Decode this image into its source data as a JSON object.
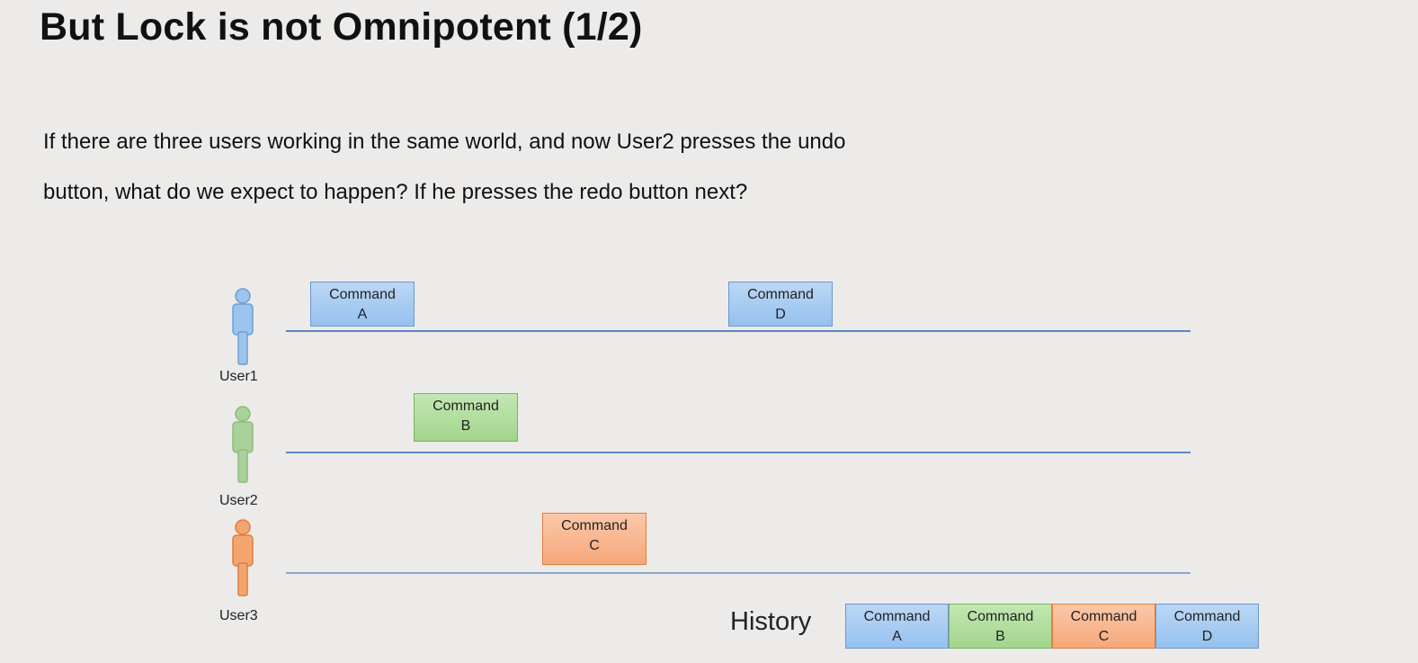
{
  "slide": {
    "title": "But Lock is not Omnipotent (1/2)",
    "body_line1": "If there are three users working in the same world, and now User2 presses the undo",
    "body_line2": "button, what do we expect to happen? If he presses the redo button next?"
  },
  "users": [
    {
      "label": "User1",
      "color": "#9cc4ec"
    },
    {
      "label": "User2",
      "color": "#a9d19a"
    },
    {
      "label": "User3",
      "color": "#f4a56e"
    }
  ],
  "commands": {
    "a": {
      "line1": "Command",
      "line2": "A",
      "user": "User1"
    },
    "b": {
      "line1": "Command",
      "line2": "B",
      "user": "User2"
    },
    "c": {
      "line1": "Command",
      "line2": "C",
      "user": "User3"
    },
    "d": {
      "line1": "Command",
      "line2": "D",
      "user": "User1"
    }
  },
  "history": {
    "label": "History",
    "items": [
      {
        "line1": "Command",
        "line2": "A"
      },
      {
        "line1": "Command",
        "line2": "B"
      },
      {
        "line1": "Command",
        "line2": "C"
      },
      {
        "line1": "Command",
        "line2": "D"
      }
    ]
  }
}
